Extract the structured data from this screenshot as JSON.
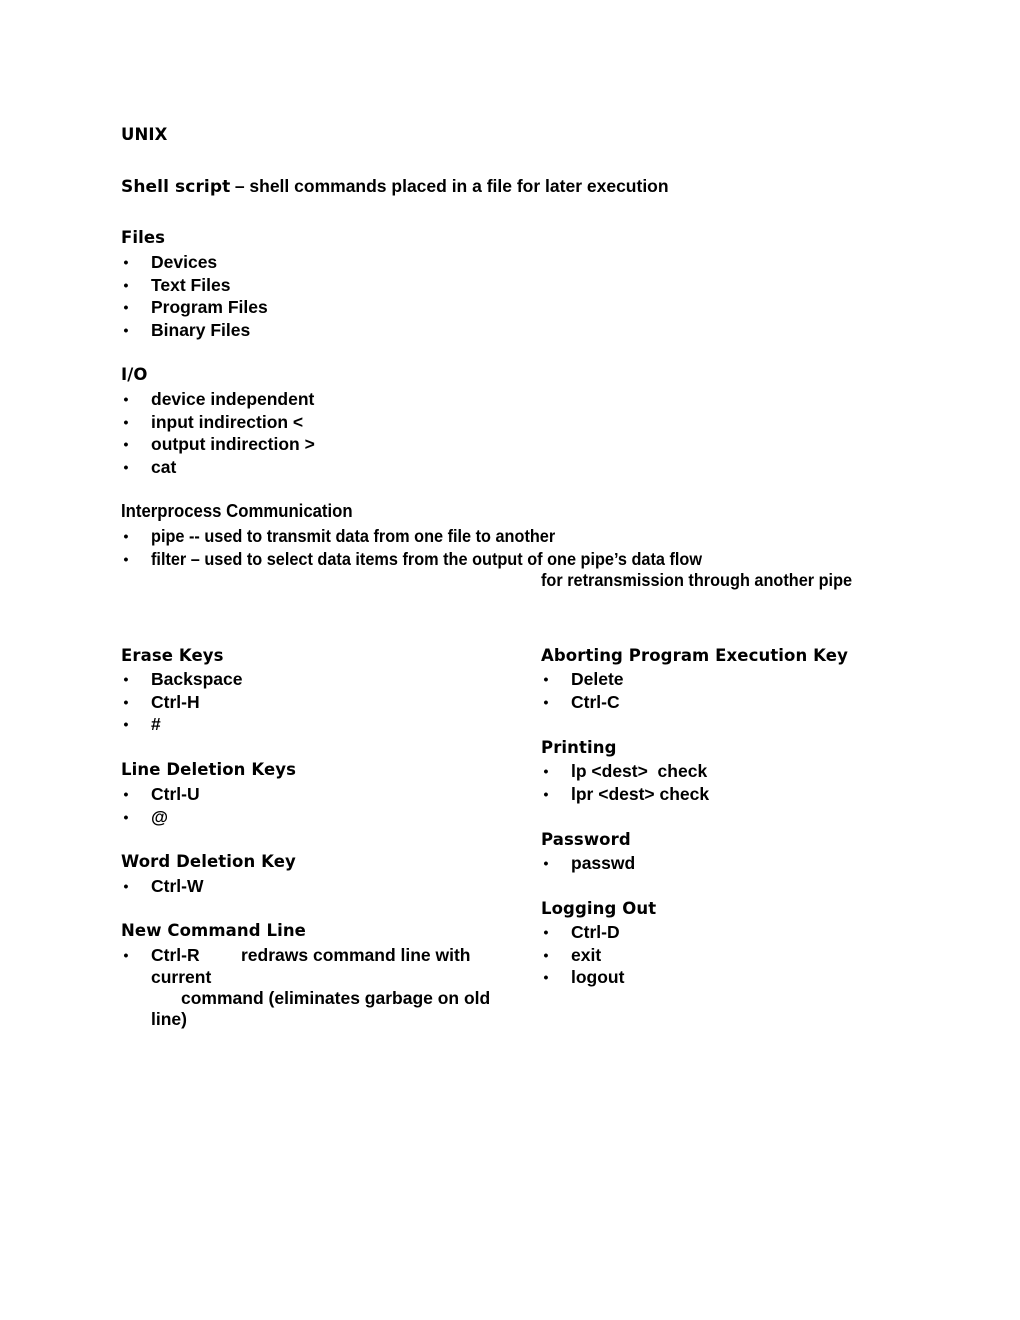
{
  "title": "UNIX",
  "definition": {
    "term": "Shell script",
    "description": "– shell commands placed in a file for later execution"
  },
  "files": {
    "heading": "Files",
    "items": [
      "Devices",
      "Text Files",
      "Program Files",
      "Binary Files"
    ]
  },
  "io": {
    "heading": "I/O",
    "items": [
      "device independent",
      "input indirection <",
      "output indirection >",
      "cat"
    ]
  },
  "ipc": {
    "heading": "Interprocess Communication",
    "items": [
      "pipe  -- used to transmit data from one file to another",
      "filter – used to select data items from the output of one pipe’s data flow"
    ],
    "continuation": "for retransmission through another pipe"
  },
  "left_column": {
    "erase_keys": {
      "heading": "Erase Keys",
      "items": [
        "Backspace",
        "Ctrl-H",
        "#"
      ]
    },
    "line_deletion_keys": {
      "heading": "Line Deletion Keys",
      "items": [
        "Ctrl-U",
        "@"
      ]
    },
    "word_deletion_key": {
      "heading": "Word Deletion Key",
      "items": [
        "Ctrl-W"
      ]
    },
    "new_command_line": {
      "heading": "New Command Line",
      "key": "Ctrl-R",
      "line1": "redraws command line with",
      "line2": "current",
      "line3": "command (eliminates garbage on old",
      "line4": "line)"
    }
  },
  "right_column": {
    "aborting": {
      "heading": "Aborting Program Execution Key",
      "items": [
        "Delete",
        "Ctrl-C"
      ]
    },
    "printing": {
      "heading": "Printing",
      "items": [
        "lp <dest>  check",
        "lpr <dest> check"
      ]
    },
    "password": {
      "heading": "Password",
      "items": [
        "passwd"
      ]
    },
    "logging_out": {
      "heading": "Logging Out",
      "items": [
        "Ctrl-D",
        "exit",
        "logout"
      ]
    }
  },
  "bullet_glyph": "•"
}
